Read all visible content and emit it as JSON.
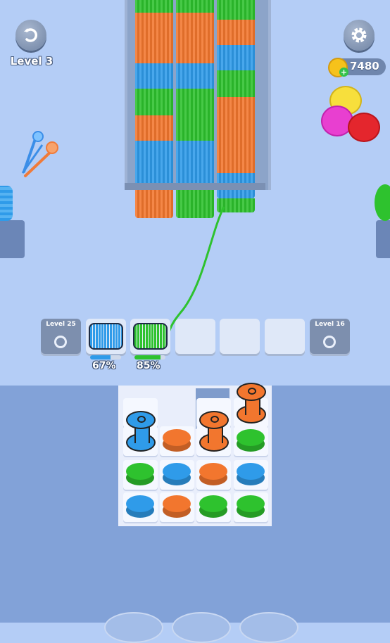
{
  "hud": {
    "level_label": "Level 3",
    "coins": "7480",
    "restart_icon": "restart-icon",
    "settings_icon": "gear-icon"
  },
  "slots": [
    {
      "state": "locked",
      "label": "Level 25"
    },
    {
      "state": "spool",
      "color": "#2f9be9",
      "percent": "67%",
      "fill": 0.67
    },
    {
      "state": "spool",
      "color": "#2ec22e",
      "percent": "85%",
      "fill": 0.85
    },
    {
      "state": "empty"
    },
    {
      "state": "empty"
    },
    {
      "state": "empty"
    },
    {
      "state": "locked",
      "label": "Level 16"
    }
  ],
  "colors": {
    "blue": "#2f9be9",
    "green": "#2ec22e",
    "orange": "#f2762e",
    "background": "#b4cdf6"
  },
  "grid": [
    [
      "empty",
      "hole",
      "empty",
      "orange-tall"
    ],
    [
      "blue-tall",
      "orange",
      "orange-tall",
      "green"
    ],
    [
      "green",
      "blue",
      "orange",
      "blue"
    ],
    [
      "blue",
      "orange",
      "green",
      "green"
    ]
  ]
}
